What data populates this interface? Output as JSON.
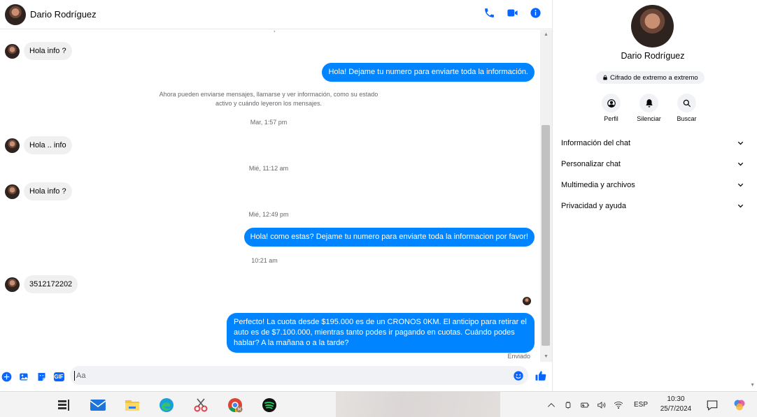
{
  "header": {
    "contact_name": "Dario Rodríguez",
    "actions": [
      {
        "icon": "phone-icon"
      },
      {
        "icon": "video-icon"
      },
      {
        "icon": "info-icon"
      }
    ]
  },
  "conversation": {
    "cut_top_text": "· ·  · , ·",
    "messages": [
      {
        "type": "incoming",
        "text": "Hola info ?"
      },
      {
        "type": "outgoing",
        "text": "Hola! Dejame tu numero  para enviarte toda la información."
      },
      {
        "type": "notice",
        "text": "Ahora pueden enviarse mensajes, llamarse y ver información, como su estado activo y cuándo leyeron los mensajes."
      },
      {
        "type": "timestamp",
        "text": "Mar, 1:57 pm"
      },
      {
        "type": "incoming",
        "text": "Hola .. info"
      },
      {
        "type": "timestamp",
        "text": "Mié, 11:12 am"
      },
      {
        "type": "incoming",
        "text": "Hola info ?"
      },
      {
        "type": "timestamp",
        "text": "Mié, 12:49 pm"
      },
      {
        "type": "outgoing",
        "text": "Hola! como estas? Dejame tu numero para enviarte toda la informacion por favor!"
      },
      {
        "type": "timestamp",
        "text": "10:21 am"
      },
      {
        "type": "incoming",
        "text": "3512172202"
      },
      {
        "type": "outgoing",
        "text": "Perfecto! La cuota desde $195.000 es de un CRONOS 0KM. El anticipo para retirar el auto es de $7.100.000, mientras tanto podes ir pagando en cuotas. Cuándo podes hablar? A la mañana o a la tarde?"
      }
    ],
    "sent_status": "Enviado"
  },
  "composer": {
    "placeholder": "Aa",
    "value": "",
    "left_icons": [
      "plus-icon",
      "photo-icon",
      "sticker-icon",
      "gif-icon"
    ],
    "gif_label": "GIF"
  },
  "info_panel": {
    "name": "Dario Rodríguez",
    "encryption_badge": "Cifrado de extremo a extremo",
    "quick_actions": [
      {
        "label": "Perfil",
        "icon": "profile-icon"
      },
      {
        "label": "Silenciar",
        "icon": "bell-icon"
      },
      {
        "label": "Buscar",
        "icon": "search-icon"
      }
    ],
    "menu": [
      {
        "label": "Información del chat"
      },
      {
        "label": "Personalizar chat"
      },
      {
        "label": "Multimedia y archivos"
      },
      {
        "label": "Privacidad y ayuda"
      }
    ]
  },
  "taskbar": {
    "apps": [
      "task-view-icon",
      "mail-icon",
      "file-explorer-icon",
      "edge-icon",
      "snipping-tool-icon",
      "chrome-icon",
      "spotify-icon"
    ],
    "tray": {
      "language": "ESP",
      "time": "10:30",
      "date": "25/7/2024"
    }
  },
  "colors": {
    "accent": "#0084ff",
    "icon_blue": "#0866ff",
    "incoming_bubble": "#f0f0f0",
    "meta_text": "#65676b"
  }
}
